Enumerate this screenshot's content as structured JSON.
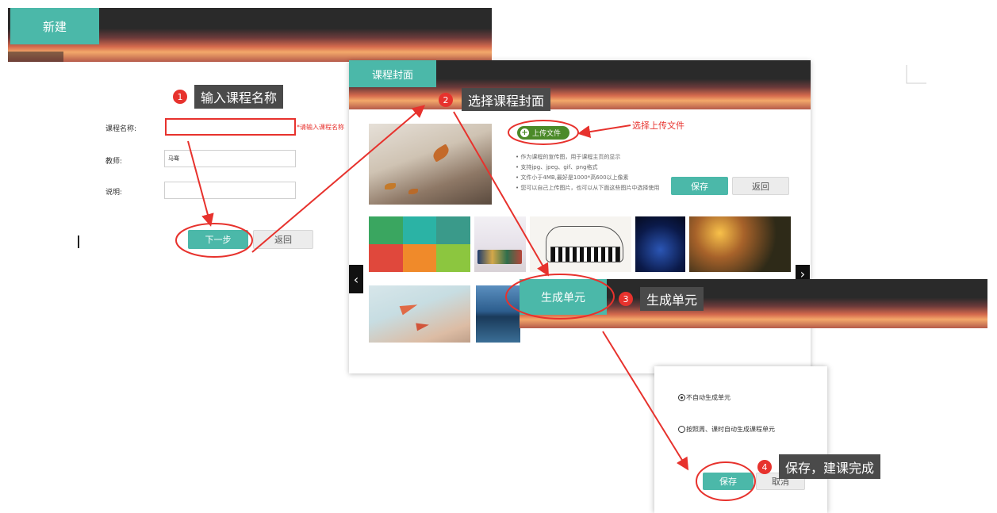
{
  "step1": {
    "tab": "新建",
    "course_name_label": "课程名称:",
    "course_name_value": "",
    "course_name_error": "*请输入课程名称",
    "teacher_label": "教师:",
    "teacher_value": "马骞",
    "desc_label": "说明:",
    "desc_value": "",
    "next_button": "下一步",
    "back_button": "返回",
    "callout_number": "1",
    "callout_text": "输入课程名称"
  },
  "step2": {
    "tab": "课程封面",
    "upload_button": "上传文件",
    "upload_hint": "选择上传文件",
    "bullets": [
      "作为课程的宣传图，用于课程主页的显示",
      "支持jpg、jpeg、gif、png格式",
      "文件小于4MB,最好是1000*高600以上像素",
      "您可以自己上传图片，也可以从下面这些图片中选择使用"
    ],
    "save_button": "保存",
    "back_button": "返回",
    "callout_number": "2",
    "callout_text": "选择课程封面",
    "prev_icon": "chevron-left-icon",
    "next_icon": "chevron-right-icon"
  },
  "step3": {
    "tab": "生成单元",
    "callout_number": "3",
    "callout_text": "生成单元"
  },
  "step4": {
    "option1": "不自动生成单元",
    "option2": "按照周、课时自动生成课程单元",
    "save_button": "保存",
    "cancel_button": "取消",
    "callout_number": "4",
    "callout_text": "保存，建课完成"
  },
  "colors": {
    "accent": "#4bb8a9",
    "annotation_red": "#e7322d",
    "header_dark": "#2a2a2a",
    "callout_bg": "#4a4a4a"
  }
}
